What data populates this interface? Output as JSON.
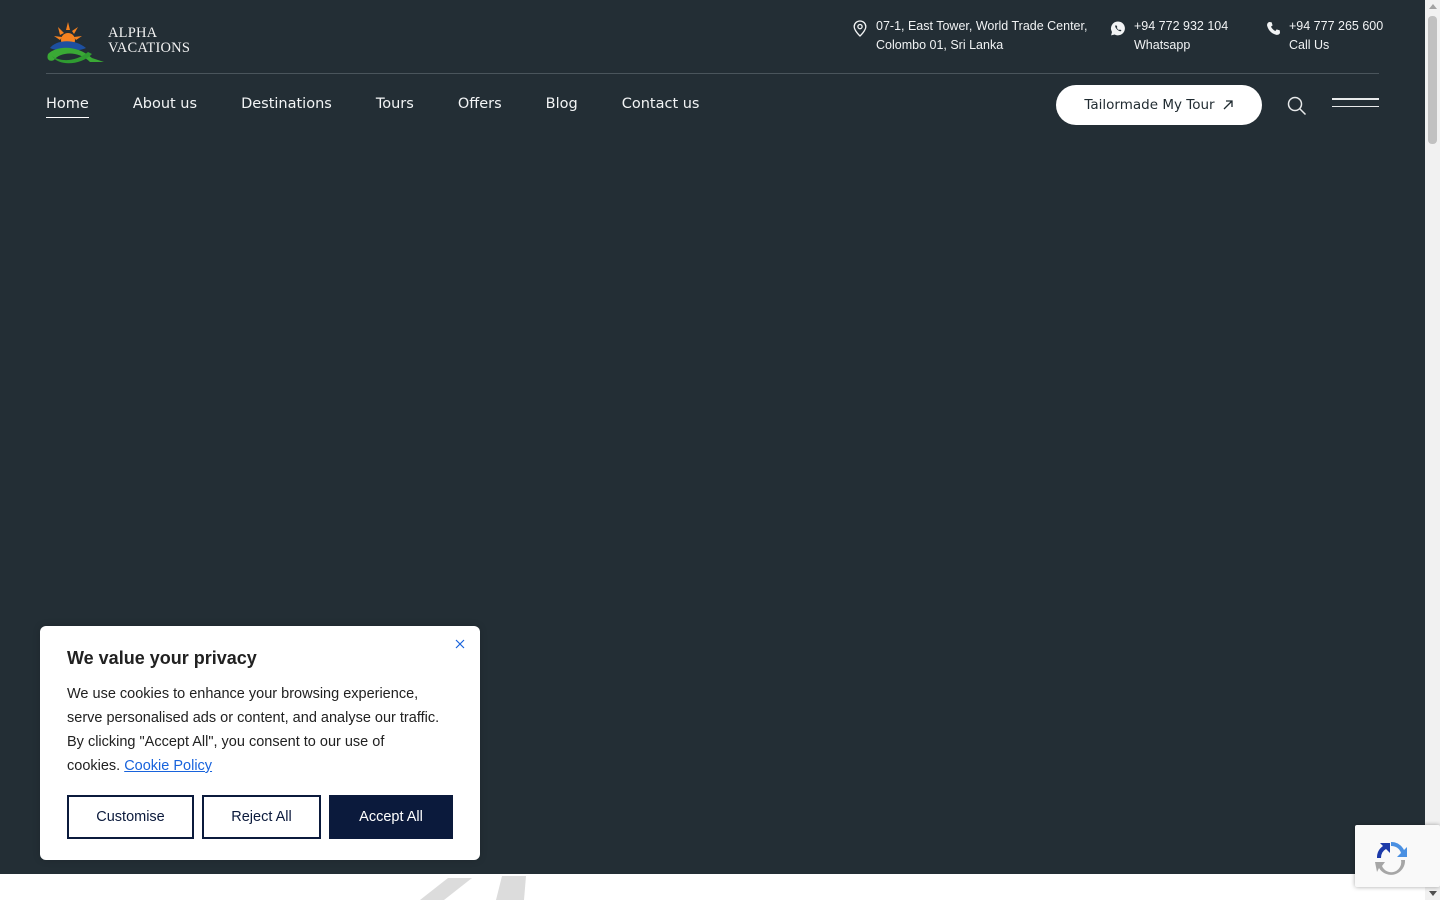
{
  "brand": {
    "line1": "ALPHA",
    "line2": "VACATIONS"
  },
  "contacts": {
    "address": {
      "line1": "07-1, East Tower, World Trade Center,",
      "line2": "Colombo 01, Sri Lanka",
      "icon": "location-pin-icon"
    },
    "whatsapp": {
      "line1": "+94 772 932 104",
      "line2": "Whatsapp",
      "icon": "whatsapp-icon"
    },
    "phone": {
      "line1": "+94 777 265 600",
      "line2": "Call Us",
      "icon": "phone-icon"
    }
  },
  "nav": {
    "items": [
      {
        "label": "Home",
        "active": true
      },
      {
        "label": "About us"
      },
      {
        "label": "Destinations"
      },
      {
        "label": "Tours"
      },
      {
        "label": "Offers"
      },
      {
        "label": "Blog"
      },
      {
        "label": "Contact us"
      }
    ],
    "cta_label": "Tailormade My Tour",
    "search_icon": "search-icon",
    "menu_icon": "hamburger-menu-icon"
  },
  "cookie_banner": {
    "title": "We value your privacy",
    "body": "We use cookies to enhance your browsing experience, serve personalised ads or content, and analyse our traffic. By clicking \"Accept All\", you consent to our use of cookies.",
    "link_label": "Cookie Policy",
    "customise_label": "Customise",
    "reject_label": "Reject All",
    "accept_label": "Accept All"
  },
  "colors": {
    "header_bg": "#232e35",
    "accept_button": "#0b1a3c",
    "link": "#1863dc"
  }
}
